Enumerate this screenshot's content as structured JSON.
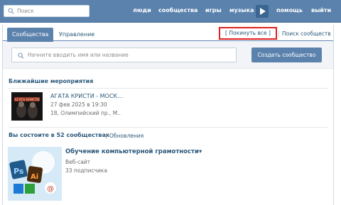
{
  "header": {
    "search_placeholder": "Поиск",
    "nav": [
      "люди",
      "сообщества",
      "игры",
      "музыка",
      "помощь",
      "выйти"
    ]
  },
  "tabs": {
    "active": "Сообщества",
    "manage": "Управление",
    "leave_all": "[ Покинуть все ]",
    "search_communities": "Поиск сообществ"
  },
  "filter": {
    "placeholder": "Начните вводить имя или название",
    "create_button": "Создать сообщество"
  },
  "events": {
    "section_title": "Ближайшие мероприятия",
    "items": [
      {
        "thumb_text": "АГАТА КРИСТИ",
        "title": "АГАТА КРИСТИ - МОСК...",
        "date": "27 фев 2025 в 19:30",
        "place": "18, Олимпийский пр., М.."
      }
    ]
  },
  "groups": {
    "section_title": "Вы состоите в 52 сообществах",
    "separator": "|",
    "updates_link": "Обновления",
    "items": [
      {
        "title": "Обучение компьютерной грамотности",
        "type": "Веб-сайт",
        "subscribers": "33 подписчика",
        "thumb_labels": [
          "Ps",
          "Ai"
        ]
      }
    ]
  },
  "colors": {
    "topbar": "#5b82ad",
    "link": "#2b587a",
    "highlight": "#e02020"
  }
}
